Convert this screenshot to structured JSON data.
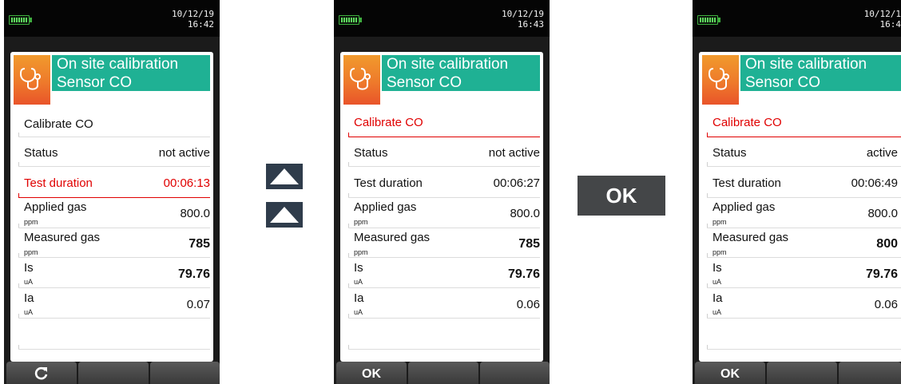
{
  "devices": [
    {
      "datetime": "10/12/19\n16:42",
      "title1": "On site calibration",
      "title2": "Sensor CO",
      "calibrate": "Calibrate CO",
      "status_label": "Status",
      "status_value": "not active",
      "duration_label": "Test duration",
      "duration_value": "00:06:13",
      "applied_label": "Applied gas",
      "applied_unit": "ppm",
      "applied_value": "800.0",
      "measured_label": "Measured gas",
      "measured_unit": "ppm",
      "measured_value": "785",
      "is_label": "Is",
      "is_unit": "uA",
      "is_value": "79.76",
      "ia_label": "Ia",
      "ia_unit": "uA",
      "ia_value": "0.07",
      "softkey1": "⟳",
      "softkey2": "",
      "softkey3": ""
    },
    {
      "datetime": "10/12/19\n16:43",
      "title1": "On site calibration",
      "title2": "Sensor CO",
      "calibrate": "Calibrate CO",
      "status_label": "Status",
      "status_value": "not active",
      "duration_label": "Test duration",
      "duration_value": "00:06:27",
      "applied_label": "Applied gas",
      "applied_unit": "ppm",
      "applied_value": "800.0",
      "measured_label": "Measured gas",
      "measured_unit": "ppm",
      "measured_value": "785",
      "is_label": "Is",
      "is_unit": "uA",
      "is_value": "79.76",
      "ia_label": "Ia",
      "ia_unit": "uA",
      "ia_value": "0.06",
      "softkey1": "OK",
      "softkey2": "",
      "softkey3": ""
    },
    {
      "datetime": "10/12/1\n16:4",
      "title1": "On site calibration",
      "title2": "Sensor CO",
      "calibrate": "Calibrate CO",
      "status_label": "Status",
      "status_value": "active",
      "duration_label": "Test duration",
      "duration_value": "00:06:49",
      "applied_label": "Applied gas",
      "applied_unit": "ppm",
      "applied_value": "800.0",
      "measured_label": "Measured gas",
      "measured_unit": "ppm",
      "measured_value": "800",
      "is_label": "Is",
      "is_unit": "uA",
      "is_value": "79.76",
      "ia_label": "Ia",
      "ia_unit": "uA",
      "ia_value": "0.06",
      "softkey1": "OK",
      "softkey2": "",
      "softkey3": ""
    }
  ],
  "ok_key_label": "OK",
  "icons": {
    "up_arrow": "up-arrow-icon",
    "stethoscope": "stethoscope-icon",
    "refresh": "refresh-icon"
  },
  "colors": {
    "header_teal": "#1fb194",
    "icon_orange": "#ee7a2b",
    "highlight_red": "#e00000",
    "arrow_key": "#2f3c4b"
  }
}
